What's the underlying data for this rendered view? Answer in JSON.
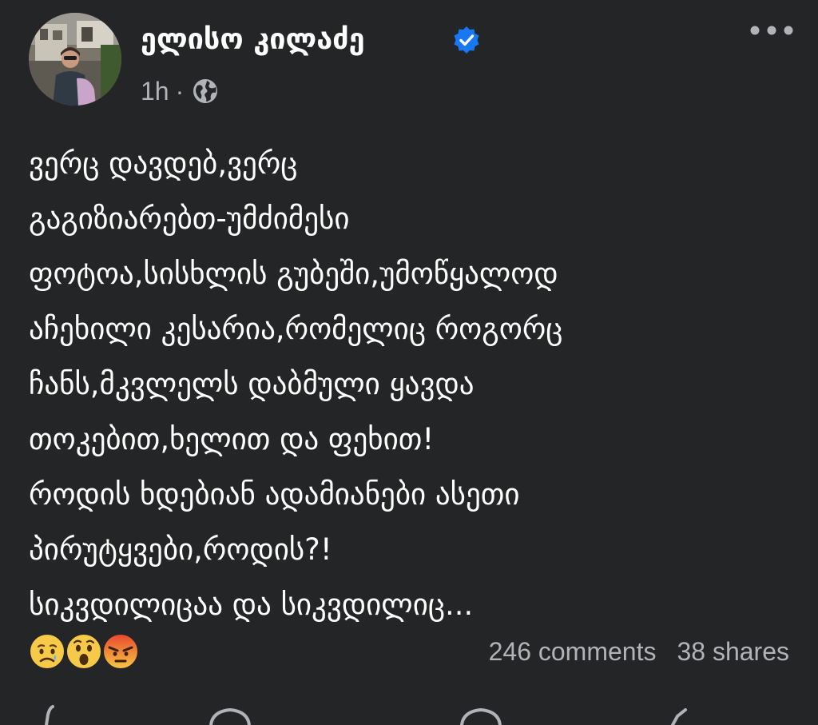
{
  "post": {
    "author": "ელისო კილაძე",
    "time": "1h",
    "separator": "·",
    "privacy_icon": "globe-icon",
    "verified_icon": "verified-badge-icon",
    "more_icon": "more-options-icon",
    "text_lines": [
      "ვერც დავდებ,ვერც",
      "გაგიზიარებთ-უმძიმესი",
      "ფოტოა,სისხლის გუბეში,უმოწყალოდ",
      "აჩეხილი კესარია,რომელიც როგორც",
      "ჩანს,მკვლელს დაბმული ყავდა",
      "თოკებით,ხელით და ფეხით!",
      "როდის ხდებიან ადამიანები ასეთი",
      "პირუტყვები,როდის?!",
      "სიკვდილიცაა და სიკვდილიც..."
    ],
    "reactions": [
      "sad-reaction-icon",
      "wow-reaction-icon",
      "angry-reaction-icon"
    ],
    "comments": "246 comments",
    "shares": "38 shares"
  },
  "colors": {
    "background": "#242526",
    "text": "#ffffff",
    "secondary_text": "#b0b3b8",
    "verified_blue": "#1877f2"
  }
}
